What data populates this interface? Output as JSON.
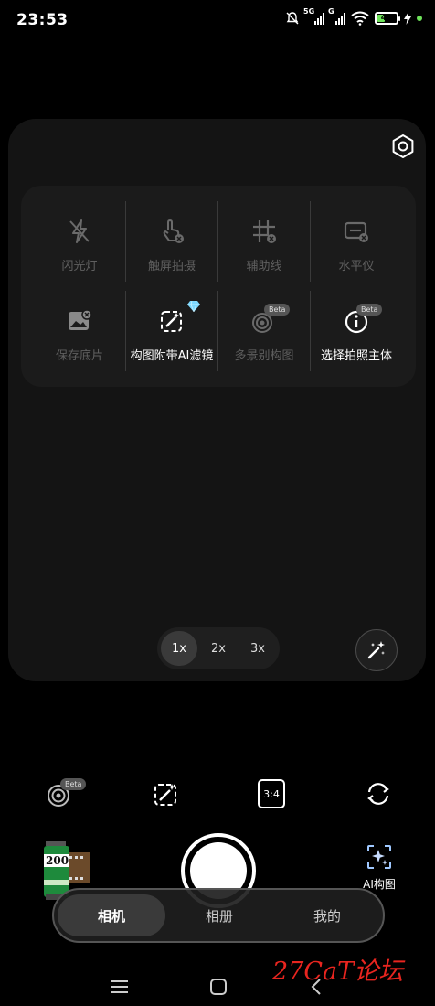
{
  "status_bar": {
    "time": "23:53",
    "network_1": "5G",
    "network_2": "G",
    "battery_level": "47",
    "battery_percent": 47
  },
  "quick_settings": {
    "items": [
      {
        "label": "闪光灯",
        "icon": "flash-off-icon",
        "enabled": false
      },
      {
        "label": "触屏拍摄",
        "icon": "touch-capture-icon",
        "enabled": false
      },
      {
        "label": "辅助线",
        "icon": "grid-lines-icon",
        "enabled": false
      },
      {
        "label": "水平仪",
        "icon": "level-icon",
        "enabled": false
      },
      {
        "label": "保存底片",
        "icon": "save-original-icon",
        "enabled": false
      },
      {
        "label": "构图附带AI滤镜",
        "icon": "ai-filter-icon",
        "enabled": true,
        "badge": "diamond"
      },
      {
        "label": "多景别构图",
        "icon": "multi-shot-icon",
        "enabled": false,
        "badge": "Beta"
      },
      {
        "label": "选择拍照主体",
        "icon": "subject-select-icon",
        "enabled": true,
        "badge": "Beta"
      }
    ]
  },
  "zoom": {
    "options": [
      "1x",
      "2x",
      "3x"
    ],
    "selected": "1x"
  },
  "toolbar": {
    "multi_shot_badge": "Beta",
    "aspect_ratio": "3:4"
  },
  "camera": {
    "film_label": "200",
    "ai_compose_label": "AI构图"
  },
  "tabs": {
    "items": [
      "相机",
      "相册",
      "我的"
    ],
    "active": "相机"
  },
  "watermark": "27CaT论坛",
  "colors": {
    "battery": "#6ee35a",
    "accent_gem": "#7ad8ff",
    "watermark": "#e8251f"
  }
}
